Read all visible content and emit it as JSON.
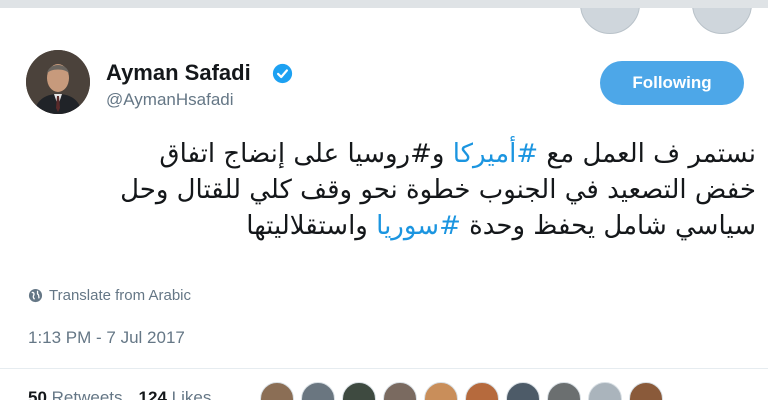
{
  "author": {
    "name": "Ayman Safadi",
    "handle": "@AymanHsafadi",
    "verified_icon": "verified-badge-icon",
    "accent_color": "#1da1f2"
  },
  "follow_button": {
    "label": "Following",
    "color": "#4da7e8"
  },
  "tweet": {
    "lines": [
      [
        {
          "text": "نستمر ف العمل مع ",
          "tag": false
        },
        {
          "text": "#أميركا",
          "tag": true
        },
        {
          "text": " و",
          "tag": false
        },
        {
          "text": "#روسيا",
          "tag": false
        },
        {
          "text": " على إنضاج اتفاق",
          "tag": false
        }
      ],
      [
        {
          "text": "خفض التصعيد في الجنوب خطوة نحو وقف كلي للقتال وحل",
          "tag": false
        }
      ],
      [
        {
          "text": "سياسي شامل يحفظ وحدة ",
          "tag": false
        },
        {
          "text": "#سوريا",
          "tag": true
        },
        {
          "text": " واستقلاليتها",
          "tag": false
        }
      ]
    ],
    "hashtag_color": "#1b95e0"
  },
  "translate": {
    "label": "Translate from Arabic",
    "icon": "globe-icon"
  },
  "timestamp": "1:13 PM - 7 Jul 2017",
  "stats": {
    "retweets_count": "50",
    "retweets_label": "Retweets",
    "likes_count": "124",
    "likes_label": "Likes"
  },
  "likers": [
    {
      "color": "#8b6e55"
    },
    {
      "color": "#6a7680"
    },
    {
      "color": "#3e4a40"
    },
    {
      "color": "#7a6a60"
    },
    {
      "color": "#c98e5a"
    },
    {
      "color": "#b66a3d"
    },
    {
      "color": "#4d5b68"
    },
    {
      "color": "#6b6f70"
    },
    {
      "color": "#aab4bc"
    },
    {
      "color": "#8a5a3a"
    }
  ]
}
